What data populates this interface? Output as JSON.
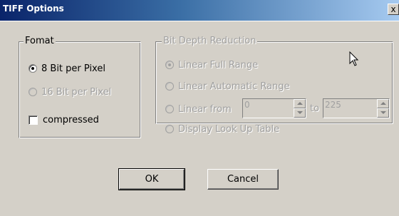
{
  "window": {
    "title": "TIFF Options",
    "close_symbol": "x"
  },
  "format_group": {
    "label": "Fomat",
    "radio_8bit": {
      "label": "8 Bit per Pixel",
      "checked": true,
      "enabled": true
    },
    "radio_16bit": {
      "label": "16 Bit per Pixel",
      "checked": false,
      "enabled": false
    },
    "compressed": {
      "label": "compressed",
      "checked": false,
      "enabled": true
    }
  },
  "bit_depth_group": {
    "label": "Bit Depth Reduction",
    "enabled": false,
    "linear_full_range": {
      "label": "Linear Full Range",
      "checked": true
    },
    "linear_automatic_range": {
      "label": "Linear Automatic Range",
      "checked": false
    },
    "linear_from": {
      "label": "Linear from",
      "checked": false
    },
    "from_value": "0",
    "to_label": "to",
    "to_value": "225",
    "display_lut": {
      "label": "Display Look Up Table",
      "checked": false
    }
  },
  "buttons": {
    "ok": "OK",
    "cancel": "Cancel"
  },
  "colors": {
    "title_bar_start": "#0a246a",
    "title_bar_end": "#a6caf0",
    "dialog_face": "#d4d0c8",
    "disabled_text": "#a0a0a0"
  },
  "icons": {
    "cursor": "arrow-cursor-icon"
  }
}
